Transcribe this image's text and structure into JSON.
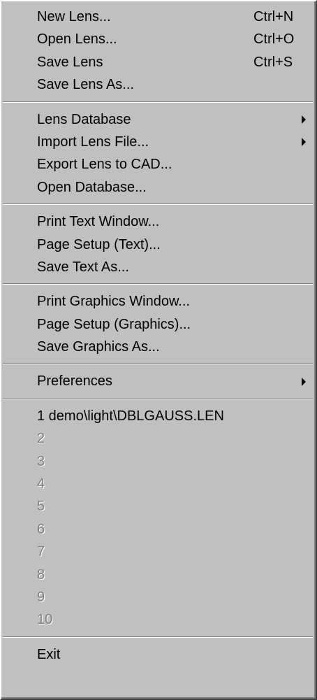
{
  "menu": {
    "group1": [
      {
        "label": "New Lens...",
        "shortcut": "Ctrl+N"
      },
      {
        "label": "Open Lens...",
        "shortcut": "Ctrl+O"
      },
      {
        "label": "Save Lens",
        "shortcut": "Ctrl+S"
      },
      {
        "label": "Save Lens As..."
      }
    ],
    "group2": [
      {
        "label": "Lens Database",
        "submenu_icon": "submenu-arrow-icon"
      },
      {
        "label": "Import Lens File...",
        "submenu_icon": "submenu-arrow-icon"
      },
      {
        "label": "Export Lens to CAD..."
      },
      {
        "label": "Open Database..."
      }
    ],
    "group3": [
      {
        "label": "Print Text Window..."
      },
      {
        "label": "Page Setup (Text)..."
      },
      {
        "label": "Save Text As..."
      }
    ],
    "group4": [
      {
        "label": "Print Graphics Window..."
      },
      {
        "label": "Page Setup (Graphics)..."
      },
      {
        "label": "Save Graphics As..."
      }
    ],
    "group5": [
      {
        "label": "Preferences",
        "submenu_icon": "submenu-arrow-icon"
      }
    ],
    "recent_files": [
      {
        "label": "1 demo\\light\\DBLGAUSS.LEN",
        "enabled": true
      },
      {
        "label": "2",
        "enabled": false
      },
      {
        "label": "3",
        "enabled": false
      },
      {
        "label": "4",
        "enabled": false
      },
      {
        "label": "5",
        "enabled": false
      },
      {
        "label": "6",
        "enabled": false
      },
      {
        "label": "7",
        "enabled": false
      },
      {
        "label": "8",
        "enabled": false
      },
      {
        "label": "9",
        "enabled": false
      },
      {
        "label": "10",
        "enabled": false
      }
    ],
    "group7": [
      {
        "label": "Exit"
      }
    ]
  },
  "colors": {
    "menu_background": "#c0c0c0",
    "text": "#000000",
    "disabled_text": "#808080",
    "disabled_highlight": "#ffffff"
  }
}
